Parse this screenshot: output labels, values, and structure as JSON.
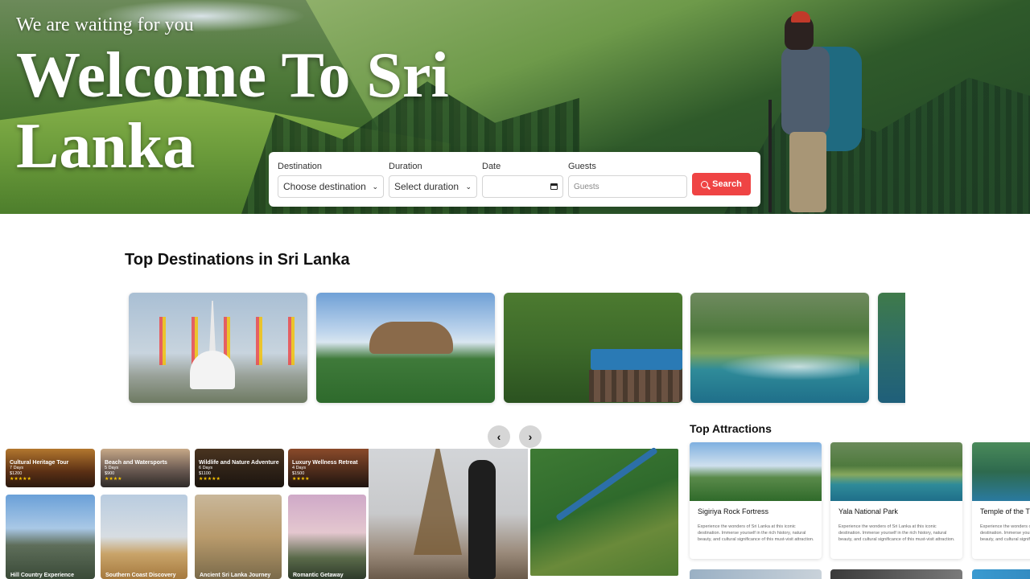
{
  "hero": {
    "tagline": "We are waiting for you",
    "title": "Welcome To Sri Lanka"
  },
  "search": {
    "destination": {
      "label": "Destination",
      "value": "Choose destination"
    },
    "duration": {
      "label": "Duration",
      "value": "Select duration"
    },
    "date": {
      "label": "Date",
      "value": ""
    },
    "guests": {
      "label": "Guests",
      "placeholder": "Guests"
    },
    "button_label": "Search"
  },
  "destinations": {
    "title": "Top Destinations in Sri Lanka"
  },
  "carousel": {
    "prev": "‹",
    "next": "›"
  },
  "tours": [
    {
      "name": "Cultural Heritage Tour",
      "days": "7 Days",
      "price": "$1200",
      "stars": "★★★★★"
    },
    {
      "name": "Beach and Watersports",
      "days": "5 Days",
      "price": "$900",
      "stars": "★★★★"
    },
    {
      "name": "Wildlife and Nature Adventure",
      "days": "6 Days",
      "price": "$1100",
      "stars": "★★★★★"
    },
    {
      "name": "Luxury Wellness Retreat",
      "days": "4 Days",
      "price": "$1500",
      "stars": "★★★★"
    }
  ],
  "tiles": [
    {
      "label": "Hill Country Experience"
    },
    {
      "label": "Southern Coast Discovery"
    },
    {
      "label": "Ancient Sri Lanka Journey"
    },
    {
      "label": "Romantic Getaway"
    }
  ],
  "attractions": {
    "title": "Top Attractions",
    "items": [
      {
        "name": "Sigiriya Rock Fortress",
        "desc": "Experience the wonders of Sri Lanka at this iconic destination. Immerse yourself in the rich history, natural beauty, and cultural significance of this must-visit attraction."
      },
      {
        "name": "Yala National Park",
        "desc": "Experience the wonders of Sri Lanka at this iconic destination. Immerse yourself in the rich history, natural beauty, and cultural significance of this must-visit attraction."
      },
      {
        "name": "Temple of the T",
        "desc": "Experience the wonders of Sri Lanka at this iconic destination. Immerse yourself in the rich history, natural beauty, and cultural significance of this must-visit attraction."
      }
    ]
  }
}
